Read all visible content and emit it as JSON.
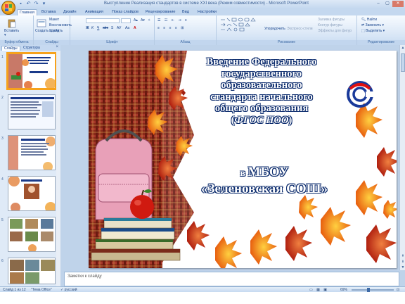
{
  "window": {
    "title": "Выступление Реализация стандартов в системе XXI века (Режим совместимости) - Microsoft PowerPoint"
  },
  "quick_access": [
    "save-icon",
    "undo-icon",
    "redo-icon",
    "dropdown-icon"
  ],
  "tabs": [
    {
      "label": "Главная",
      "active": true
    },
    {
      "label": "Вставка"
    },
    {
      "label": "Дизайн"
    },
    {
      "label": "Анимация"
    },
    {
      "label": "Показ слайдов"
    },
    {
      "label": "Рецензирование"
    },
    {
      "label": "Вид"
    },
    {
      "label": "Настройки"
    }
  ],
  "ribbon": {
    "clipboard": {
      "label": "Буфер обмена",
      "paste": "Вставить",
      "cut": "Вырезать",
      "copy": "Копировать",
      "format": "Формат по образцу"
    },
    "slides": {
      "label": "Слайды",
      "new_slide": "Создать слайд",
      "layout": "Макет",
      "reset": "Восстановить",
      "delete": "Удалить"
    },
    "font": {
      "label": "Шрифт",
      "font_name": "",
      "font_size": "",
      "bold": "Ж",
      "italic": "К",
      "underline": "Ч",
      "strike": "abc",
      "shadow": "S",
      "spacing": "AV",
      "case": "Aa",
      "color": "A"
    },
    "paragraph": {
      "label": "Абзац"
    },
    "drawing": {
      "label": "Рисование",
      "arrange": "Упорядочить",
      "quick_styles": "Экспресс-стили",
      "fill": "Заливка фигуры",
      "outline": "Контур фигуры",
      "effects": "Эффекты для фигур"
    },
    "editing": {
      "label": "Редактирование",
      "find": "Найти",
      "replace": "Заменить",
      "select": "Выделить"
    }
  },
  "left_panel": {
    "tabs": [
      "Слайды",
      "Структура"
    ],
    "close": "×",
    "slide_numbers": [
      "1",
      "2",
      "3",
      "4",
      "5",
      "6"
    ]
  },
  "slide": {
    "title_line1": "Введение Федерального",
    "title_line2": "государственного",
    "title_line3": "образовательного",
    "title_line4": "стандарта начального",
    "title_line5": "общего образования",
    "title_line6_open": "(",
    "title_line6_italic": "ФГОС НОО",
    "title_line6_close": ")",
    "sub_prefix": "в ",
    "sub_line1": "МБОУ",
    "sub_line2": "«Зеленовская СОШ»"
  },
  "notes": {
    "placeholder": "Заметки к слайду"
  },
  "status": {
    "slide_of": "Слайд 1 из 12",
    "theme": "\"Тема Office\"",
    "language": "русский",
    "zoom": "69%",
    "zoom_value": 0.4
  },
  "colors": {
    "title_fill": "#ffffff",
    "title_outline": "#0a2a6c",
    "ribbon": "#dde9f7",
    "selection": "#f6a21c"
  }
}
